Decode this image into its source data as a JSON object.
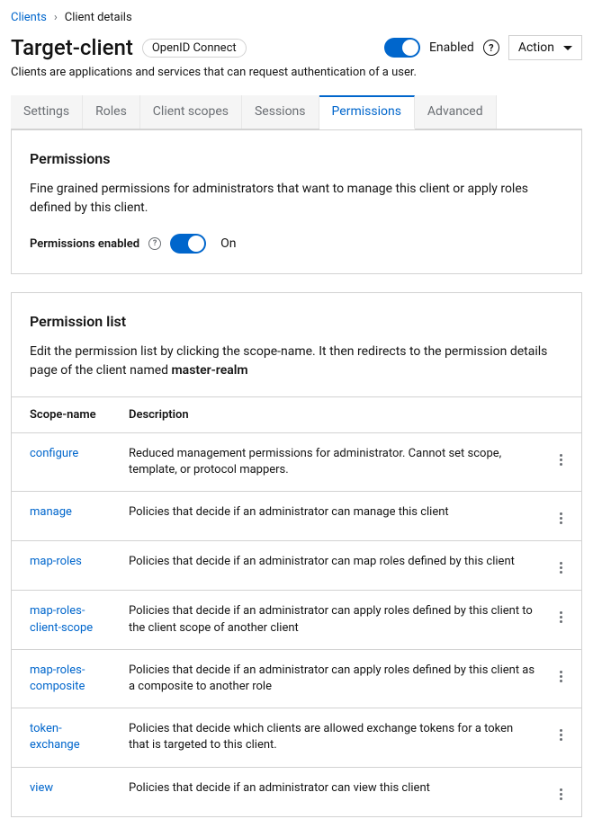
{
  "breadcrumb": {
    "root": "Clients",
    "current": "Client details"
  },
  "header": {
    "title": "Target-client",
    "badge": "OpenID Connect",
    "enabled_label": "Enabled",
    "action_label": "Action"
  },
  "subtitle": "Clients are applications and services that can request authentication of a user.",
  "tabs": {
    "settings": "Settings",
    "roles": "Roles",
    "client_scopes": "Client scopes",
    "sessions": "Sessions",
    "permissions": "Permissions",
    "advanced": "Advanced"
  },
  "permissions_card": {
    "title": "Permissions",
    "description": "Fine grained permissions for administrators that want to manage this client or apply roles defined by this client.",
    "enabled_label": "Permissions enabled",
    "switch_state": "On"
  },
  "list_card": {
    "title": "Permission list",
    "description_prefix": "Edit the permission list by clicking the scope-name. It then redirects to the permission details page of the client named ",
    "description_bold": "master-realm",
    "headers": {
      "scope": "Scope-name",
      "description": "Description"
    },
    "rows": [
      {
        "scope": "configure",
        "description": "Reduced management permissions for administrator. Cannot set scope, template, or protocol mappers."
      },
      {
        "scope": "manage",
        "description": "Policies that decide if an administrator can manage this client"
      },
      {
        "scope": "map-roles",
        "description": "Policies that decide if an administrator can map roles defined by this client"
      },
      {
        "scope": "map-roles-client-scope",
        "description": "Policies that decide if an administrator can apply roles defined by this client to the client scope of another client"
      },
      {
        "scope": "map-roles-composite",
        "description": "Policies that decide if an administrator can apply roles defined by this client as a composite to another role"
      },
      {
        "scope": "token-exchange",
        "description": "Policies that decide which clients are allowed exchange tokens for a token that is targeted to this client."
      },
      {
        "scope": "view",
        "description": "Policies that decide if an administrator can view this client"
      }
    ]
  }
}
